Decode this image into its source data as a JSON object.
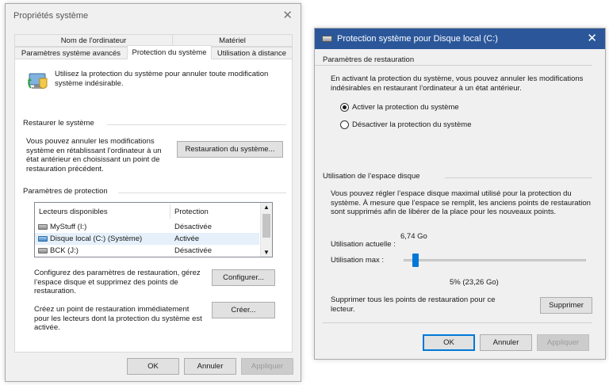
{
  "left_window": {
    "title": "Propriétés système",
    "tabs_top": [
      "Nom de l'ordinateur",
      "Matériel"
    ],
    "tabs_bottom": [
      "Paramètres système avancés",
      "Protection du système",
      "Utilisation à distance"
    ],
    "intro_text": "Utilisez la protection du système pour annuler toute modification système indésirable.",
    "restore_group": "Restaurer le système",
    "restore_text": "Vous pouvez annuler les modifications système en rétablissant l’ordinateur à un état antérieur en choisissant un point de restauration précédent.",
    "restore_button": "Restauration du système...",
    "protection_group": "Paramètres de protection",
    "list_headers": [
      "Lecteurs disponibles",
      "Protection"
    ],
    "drives": [
      {
        "name": "MyStuff (I:)",
        "status": "Désactivée",
        "icon": "drive-icon"
      },
      {
        "name": "Disque local (C:) (Système)",
        "status": "Activée",
        "icon": "system-drive-icon"
      },
      {
        "name": "BCK (J:)",
        "status": "Désactivée",
        "icon": "drive-icon"
      }
    ],
    "configure_text": "Configurez des paramètres de restauration, gérez l’espace disque et supprimez des points de restauration.",
    "configure_button": "Configurer...",
    "create_text": "Créez un point de restauration immédiatement pour les lecteurs dont la protection du système est activée.",
    "create_button": "Créer...",
    "ok": "OK",
    "cancel": "Annuler",
    "apply": "Appliquer"
  },
  "right_window": {
    "title": "Protection système pour Disque local (C:)",
    "restore_group": "Paramètres de restauration",
    "restore_text": "En activant la protection du système, vous pouvez annuler les modifications indésirables en restaurant l’ordinateur à un état antérieur.",
    "radio_on": "Activer la protection du système",
    "radio_off": "Désactiver la protection du système",
    "radio_selected": "on",
    "disk_group": "Utilisation de l’espace disque",
    "disk_text": "Vous pouvez régler l’espace disque maximal utilisé pour la protection du système. À mesure que l’espace se remplit, les anciens points de restauration sont supprimés afin de libérer de la place pour les nouveaux points.",
    "current_label": "Utilisation actuelle :",
    "current_value": "6,74 Go",
    "max_label": "Utilisation max :",
    "max_value": "5% (23,26 Go)",
    "slider_percent": 5,
    "delete_text": "Supprimer tous les points de restauration pour ce lecteur.",
    "delete_button": "Supprimer",
    "ok": "OK",
    "cancel": "Annuler",
    "apply": "Appliquer"
  }
}
